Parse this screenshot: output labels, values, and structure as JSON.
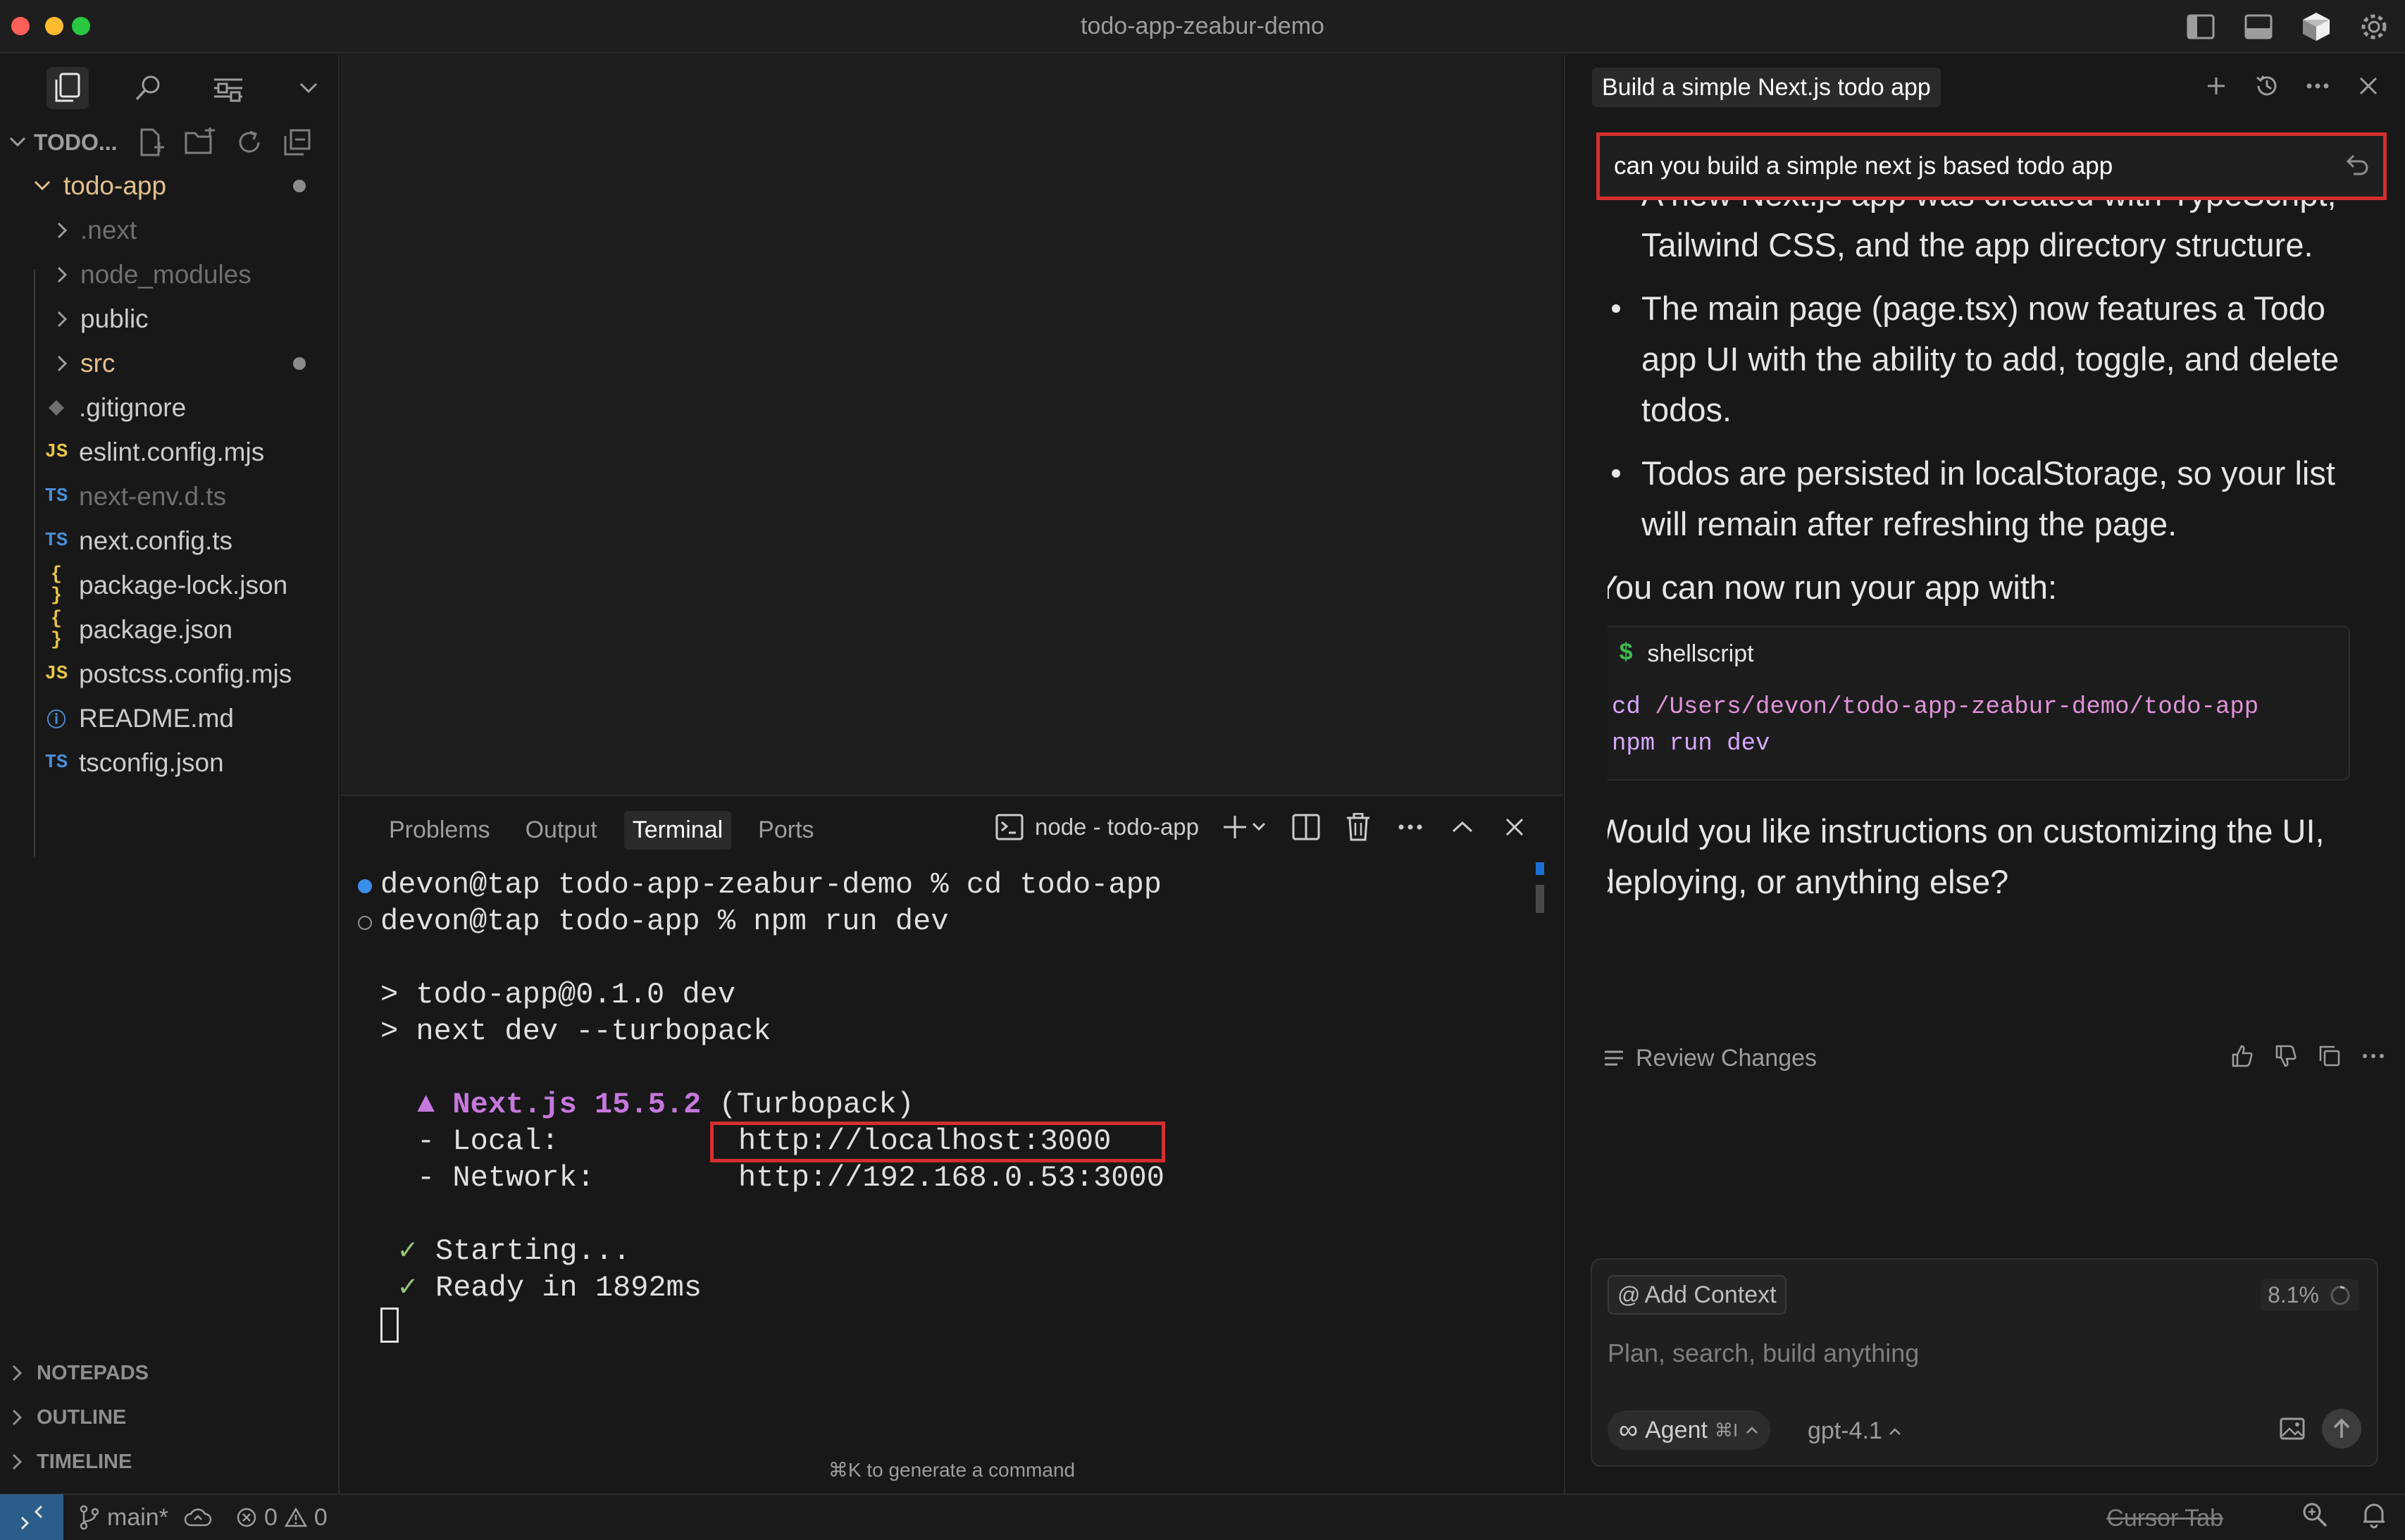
{
  "window": {
    "title": "todo-app-zeabur-demo"
  },
  "titlebar_icons": [
    "toggle-primary-sidebar-icon",
    "toggle-panel-icon",
    "cursor-logo-icon",
    "settings-gear-icon"
  ],
  "sidebar": {
    "explorer_title": "TODO...",
    "root_folder": "todo-app",
    "items": [
      {
        "label": ".next",
        "type": "folder",
        "color": "#6f6f6f"
      },
      {
        "label": "node_modules",
        "type": "folder",
        "color": "#6f6f6f"
      },
      {
        "label": "public",
        "type": "folder",
        "color": "#cccccc"
      },
      {
        "label": "src",
        "type": "folder",
        "color": "#e2c08d",
        "modified": true
      },
      {
        "label": ".gitignore",
        "type": "file",
        "icon": "git-icon",
        "badge": "◆",
        "badge_color": "#6f6f6f",
        "color": "#cccccc"
      },
      {
        "label": "eslint.config.mjs",
        "type": "file",
        "icon": "javascript-icon",
        "badge": "JS",
        "badge_color": "#e8c547",
        "color": "#cccccc"
      },
      {
        "label": "next-env.d.ts",
        "type": "file",
        "icon": "typescript-icon",
        "badge": "TS",
        "badge_color": "#4b8fd6",
        "color": "#6f6f6f"
      },
      {
        "label": "next.config.ts",
        "type": "file",
        "icon": "typescript-icon",
        "badge": "TS",
        "badge_color": "#4b8fd6",
        "color": "#cccccc"
      },
      {
        "label": "package-lock.json",
        "type": "file",
        "icon": "json-icon",
        "badge": "{ }",
        "badge_color": "#e8c547",
        "color": "#cccccc"
      },
      {
        "label": "package.json",
        "type": "file",
        "icon": "json-icon",
        "badge": "{ }",
        "badge_color": "#e8c547",
        "color": "#cccccc"
      },
      {
        "label": "postcss.config.mjs",
        "type": "file",
        "icon": "javascript-icon",
        "badge": "JS",
        "badge_color": "#e8c547",
        "color": "#cccccc"
      },
      {
        "label": "README.md",
        "type": "file",
        "icon": "info-icon",
        "badge": "ⓘ",
        "badge_color": "#4b8fd6",
        "color": "#cccccc"
      },
      {
        "label": "tsconfig.json",
        "type": "file",
        "icon": "tsconfig-icon",
        "badge": "TS",
        "badge_color": "#4b8fd6",
        "color": "#cccccc"
      }
    ],
    "sections": [
      "NOTEPADS",
      "OUTLINE",
      "TIMELINE"
    ]
  },
  "panel": {
    "tabs": [
      "Problems",
      "Output",
      "Terminal",
      "Ports"
    ],
    "active_tab": "Terminal",
    "terminal_name": "node - todo-app",
    "hint": "⌘K to generate a command"
  },
  "terminal": {
    "prompt1": "devon@tap todo-app-zeabur-demo % cd todo-app",
    "prompt2": "devon@tap todo-app % npm run dev",
    "script1": "> todo-app@0.1.0 dev",
    "script2": "> next dev --turbopack",
    "next_marker": "▲ ",
    "next_version": "Next.js 15.5.2",
    "turbopack": " (Turbopack)",
    "local_label": "- Local:",
    "local_url": "http://localhost:3000",
    "network_label": "- Network:",
    "network_url": "http://192.168.0.53:3000",
    "check": "✓",
    "starting": "Starting...",
    "ready": "Ready in 1892ms"
  },
  "chat": {
    "title": "Build a simple Next.js todo app",
    "user_query": "can you build a simple next js based todo app",
    "bullets": [
      "A new Next.js app was created with TypeScript, Tailwind CSS, and the app directory structure.",
      "The main page (page.tsx) now features a Todo app UI with the ability to add, toggle, and delete todos.",
      "Todos are persisted in localStorage, so your list will remain after refreshing the page."
    ],
    "run_text": "You can now run your app with:",
    "code_lang": "shellscript",
    "code_line1_cmd": "cd",
    "code_line1_path": " /Users/devon/todo-app-zeabur-demo/todo-app",
    "code_line2": "npm run dev",
    "question": "Would you like instructions on customizing the UI, deploying, or anything else?",
    "review_label": "Review Changes"
  },
  "composer": {
    "context_label": "Add Context",
    "usage": "8.1%",
    "placeholder": "Plan, search, build anything",
    "mode": "Agent",
    "mode_shortcut": "⌘I",
    "model": "gpt-4.1"
  },
  "statusbar": {
    "branch": "main*",
    "errors": "0",
    "warnings": "0",
    "cursor_tab": "Cursor Tab"
  }
}
